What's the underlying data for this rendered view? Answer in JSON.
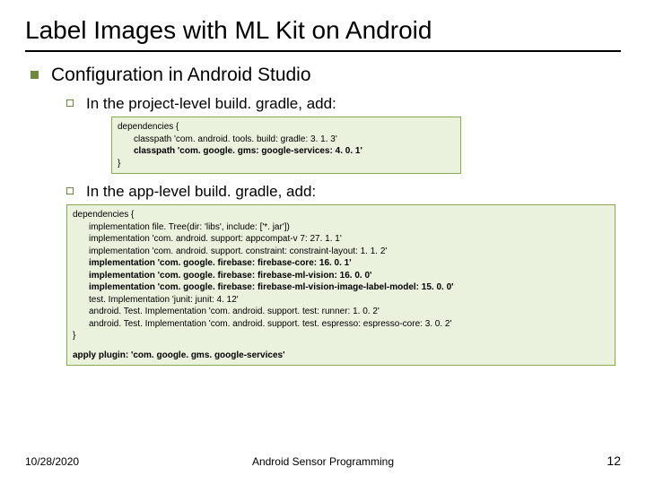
{
  "title": "Label Images with ML Kit on Android",
  "section": "Configuration in Android Studio",
  "sub1": "In the project-level build. gradle, add:",
  "code1": {
    "l1": "dependencies {",
    "l2": "classpath 'com. android. tools. build: gradle: 3. 1. 3'",
    "l3": "classpath 'com. google. gms: google-services: 4. 0. 1'",
    "l4": "}"
  },
  "sub2": "In the app-level build. gradle, add:",
  "code2": {
    "l1": "dependencies {",
    "l2": "implementation file. Tree(dir: 'libs', include: ['*. jar'])",
    "l3": "implementation 'com. android. support: appcompat-v 7: 27. 1. 1'",
    "l4": "implementation 'com. android. support. constraint: constraint-layout: 1. 1. 2'",
    "l5": "implementation 'com. google. firebase: firebase-core: 16. 0. 1'",
    "l6": "implementation 'com. google. firebase: firebase-ml-vision: 16. 0. 0'",
    "l7": "implementation 'com. google. firebase: firebase-ml-vision-image-label-model: 15. 0. 0'",
    "l8": "test. Implementation 'junit: junit: 4. 12'",
    "l9": "android. Test. Implementation 'com. android. support. test: runner: 1. 0. 2'",
    "l10": "android. Test. Implementation 'com. android. support. test. espresso: espresso-core: 3. 0. 2'",
    "l11": "}",
    "l12": "apply plugin: 'com. google. gms. google-services'"
  },
  "footer": {
    "date": "10/28/2020",
    "center": "Android Sensor Programming",
    "page": "12"
  }
}
